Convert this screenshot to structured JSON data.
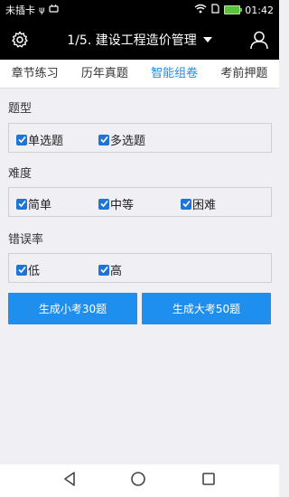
{
  "status_bar": {
    "carrier": "未插卡",
    "usb_symbol": "ψ",
    "time": "01:42"
  },
  "header": {
    "title": "1/5. 建设工程造价管理"
  },
  "tabs": [
    {
      "label": "章节练习"
    },
    {
      "label": "历年真题"
    },
    {
      "label": "智能组卷"
    },
    {
      "label": "考前押题"
    }
  ],
  "sections": {
    "type": {
      "title": "题型",
      "options": [
        {
          "label": "单选题",
          "checked": true
        },
        {
          "label": "多选题",
          "checked": true
        }
      ]
    },
    "difficulty": {
      "title": "难度",
      "options": [
        {
          "label": "简单",
          "checked": true
        },
        {
          "label": "中等",
          "checked": true
        },
        {
          "label": "困难",
          "checked": true
        }
      ]
    },
    "error_rate": {
      "title": "错误率",
      "options": [
        {
          "label": "低",
          "checked": true
        },
        {
          "label": "高",
          "checked": true
        }
      ]
    }
  },
  "buttons": {
    "small_exam": "生成小考30题",
    "big_exam": "生成大考50题"
  },
  "colors": {
    "accent": "#1e8fef",
    "active_tab": "#1f8ce8",
    "checkbox": "#1f75d6"
  }
}
